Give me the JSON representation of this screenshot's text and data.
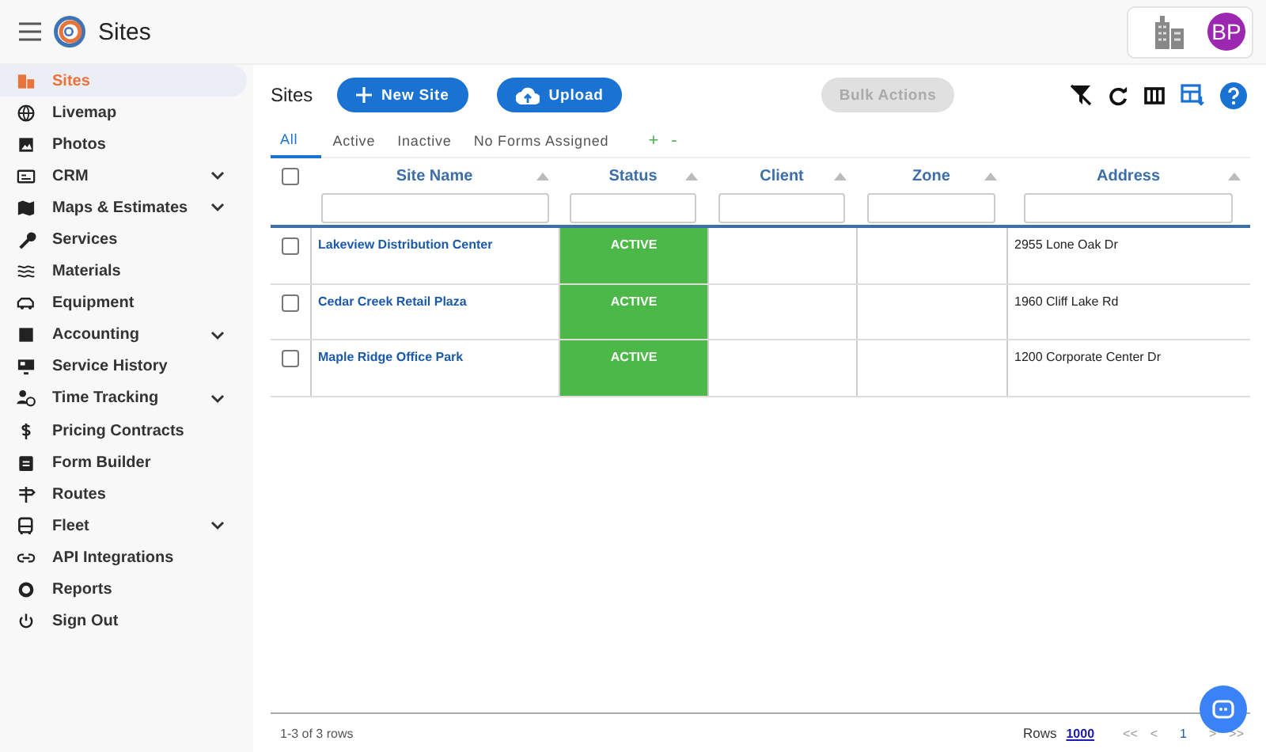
{
  "header": {
    "title": "Sites",
    "avatar": "BP"
  },
  "sidebar": {
    "items": [
      {
        "label": "Sites",
        "selected": true,
        "expandable": false
      },
      {
        "label": "Livemap",
        "selected": false,
        "expandable": false
      },
      {
        "label": "Photos",
        "selected": false,
        "expandable": false
      },
      {
        "label": "CRM",
        "selected": false,
        "expandable": true
      },
      {
        "label": "Maps & Estimates",
        "selected": false,
        "expandable": true
      },
      {
        "label": "Services",
        "selected": false,
        "expandable": false
      },
      {
        "label": "Materials",
        "selected": false,
        "expandable": false
      },
      {
        "label": "Equipment",
        "selected": false,
        "expandable": false
      },
      {
        "label": "Accounting",
        "selected": false,
        "expandable": true
      },
      {
        "label": "Service History",
        "selected": false,
        "expandable": false
      },
      {
        "label": "Time Tracking",
        "selected": false,
        "expandable": true
      },
      {
        "label": "Pricing Contracts",
        "selected": false,
        "expandable": false
      },
      {
        "label": "Form Builder",
        "selected": false,
        "expandable": false
      },
      {
        "label": "Routes",
        "selected": false,
        "expandable": false
      },
      {
        "label": "Fleet",
        "selected": false,
        "expandable": true
      },
      {
        "label": "API Integrations",
        "selected": false,
        "expandable": false
      },
      {
        "label": "Reports",
        "selected": false,
        "expandable": false
      },
      {
        "label": "Sign Out",
        "selected": false,
        "expandable": false
      }
    ]
  },
  "toolbar": {
    "title": "Sites",
    "new_button": "New Site",
    "upload_button": "Upload",
    "bulk_button": {
      "label": "Bulk Actions",
      "disabled": true
    }
  },
  "tabs": [
    {
      "label": "All",
      "selected": true
    },
    {
      "label": "Active",
      "selected": false
    },
    {
      "label": "Inactive",
      "selected": false
    },
    {
      "label": "No Forms Assigned",
      "selected": false
    }
  ],
  "tab_add": "+",
  "tab_remove": "-",
  "table": {
    "select_all_checked": false,
    "columns": [
      "Site Name",
      "Status",
      "Client",
      "Zone",
      "Address"
    ],
    "rows": [
      {
        "checked": false,
        "site_name": "Lakeview Distribution Center",
        "status": "ACTIVE",
        "address": "2955 Lone Oak Dr"
      },
      {
        "checked": false,
        "site_name": "Cedar Creek Retail Plaza",
        "status": "ACTIVE",
        "address": "1960 Cliff Lake Rd"
      },
      {
        "checked": false,
        "site_name": "Maple Ridge Office Park",
        "status": "ACTIVE",
        "address": "1200 Corporate Center Dr"
      }
    ]
  },
  "footer": {
    "count": "1-3 of 3 rows",
    "rows_label": "Rows",
    "rows_value": "1000",
    "pager": [
      "<<",
      "<",
      "1",
      ">",
      ">>"
    ]
  }
}
